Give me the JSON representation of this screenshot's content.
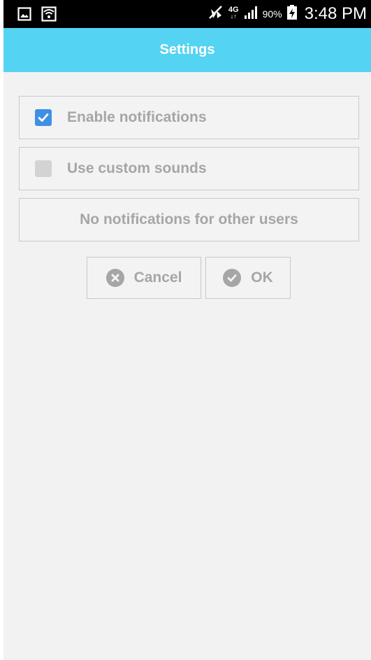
{
  "status_bar": {
    "left_icons": [
      "image-notification-icon",
      "wifi-icon"
    ],
    "right_icons": [
      "mute-icon",
      "network-4g-icon",
      "signal-icon",
      "battery-charging-icon"
    ],
    "network_type": "4G",
    "battery_percent": "90%",
    "time": "3:48 PM"
  },
  "action_bar": {
    "title": "Settings",
    "color": "#55d3f2"
  },
  "settings": {
    "enable_notifications": {
      "label": "Enable notifications",
      "checked": true
    },
    "custom_sounds": {
      "label": "Use custom sounds",
      "checked": false
    },
    "other_users_button": {
      "label": "No notifications for other users"
    }
  },
  "buttons": {
    "cancel": {
      "label": "Cancel",
      "icon": "cancel-circle-icon"
    },
    "ok": {
      "label": "OK",
      "icon": "check-circle-icon"
    }
  },
  "colors": {
    "accent_checkbox": "#3f90e3",
    "background": "#f2f2f2",
    "text_muted": "#a6a6a6"
  }
}
